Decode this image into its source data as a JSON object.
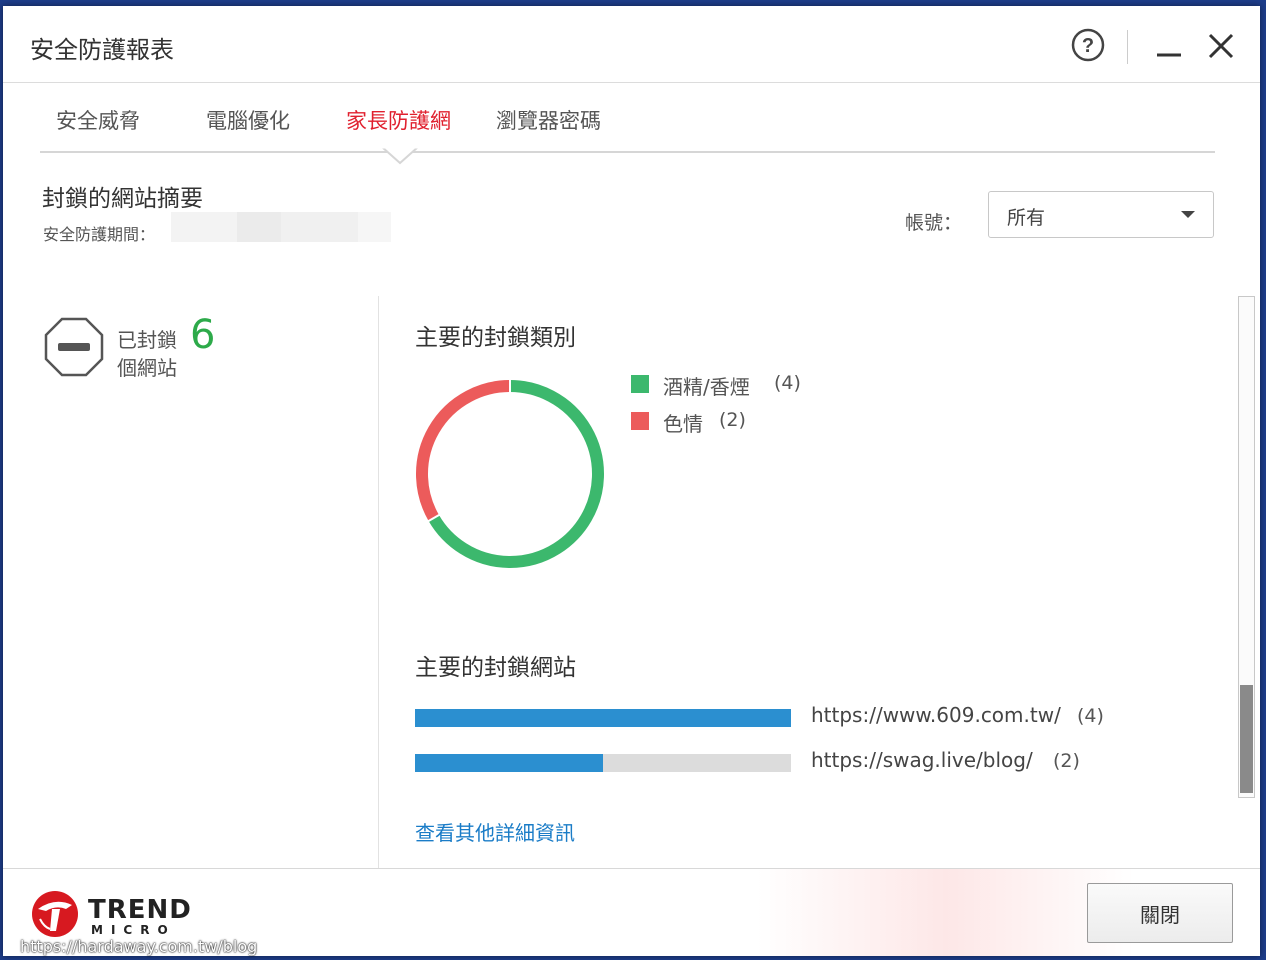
{
  "window": {
    "title": "安全防護報表"
  },
  "tabs": [
    {
      "label": "安全威脅",
      "active": false
    },
    {
      "label": "電腦優化",
      "active": false
    },
    {
      "label": "家長防護網",
      "active": true
    },
    {
      "label": "瀏覽器密碼",
      "active": false
    }
  ],
  "summary": {
    "title": "封鎖的網站摘要",
    "period_label": "安全防護期間："
  },
  "account": {
    "label": "帳號：",
    "selected": "所有"
  },
  "blocked": {
    "label": "已封鎖個網站",
    "count": "6"
  },
  "categories": {
    "title": "主要的封鎖類別",
    "items": [
      {
        "label": "酒精/香煙",
        "count": "(4)",
        "value": 4,
        "color": "#3cb86d"
      },
      {
        "label": "色情",
        "count": "(2)",
        "value": 2,
        "color": "#ec5b5b"
      }
    ]
  },
  "sites": {
    "title": "主要的封鎖網站",
    "items": [
      {
        "url": "https://www.609.com.tw/",
        "count": "(4)",
        "value": 4,
        "fraction": 1.0
      },
      {
        "url": "https://swag.live/blog/",
        "count": "(2)",
        "value": 2,
        "fraction": 0.5
      }
    ],
    "bar_color": "#2b8fd0"
  },
  "links": {
    "more_details": "查看其他詳細資訊"
  },
  "footer": {
    "logo_top": "TREND",
    "logo_bottom": "MICRO",
    "close_label": "關閉"
  },
  "watermark": "https://hardaway.com.tw/blog",
  "accent_color": "#e0202e"
}
